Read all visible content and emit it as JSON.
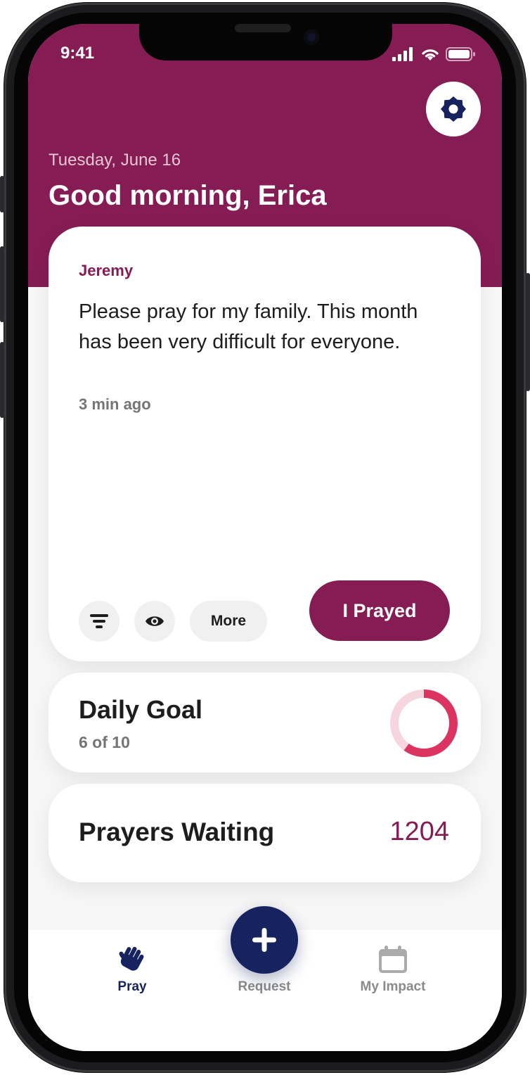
{
  "status_bar": {
    "time": "9:41"
  },
  "header": {
    "date": "Tuesday, June 16",
    "greeting": "Good morning, Erica",
    "settings_icon": "gear-icon"
  },
  "prayer_card": {
    "author": "Jeremy",
    "text": "Please pray for my family. This month has been very difficult for everyone.",
    "time_ago": "3 min ago",
    "actions": {
      "filter_icon": "filter-icon",
      "view_icon": "eye-icon",
      "more_label": "More",
      "prayed_label": "I Prayed"
    }
  },
  "daily_goal": {
    "title": "Daily Goal",
    "progress_text": "6 of 10",
    "completed": 6,
    "total": 10
  },
  "prayers_waiting": {
    "title": "Prayers Waiting",
    "count": "1204"
  },
  "tab_bar": {
    "tabs": [
      {
        "label": "Pray",
        "icon": "praying-hand-icon",
        "active": true
      },
      {
        "label": "Request",
        "icon": "plus-icon",
        "active": false
      },
      {
        "label": "My Impact",
        "icon": "calendar-icon",
        "active": false
      }
    ]
  },
  "colors": {
    "brand": "#861c54",
    "navy": "#17235f",
    "ring_active": "#dc3461",
    "ring_track": "#f6d6de",
    "tab_inactive": "#9a9a9a"
  }
}
